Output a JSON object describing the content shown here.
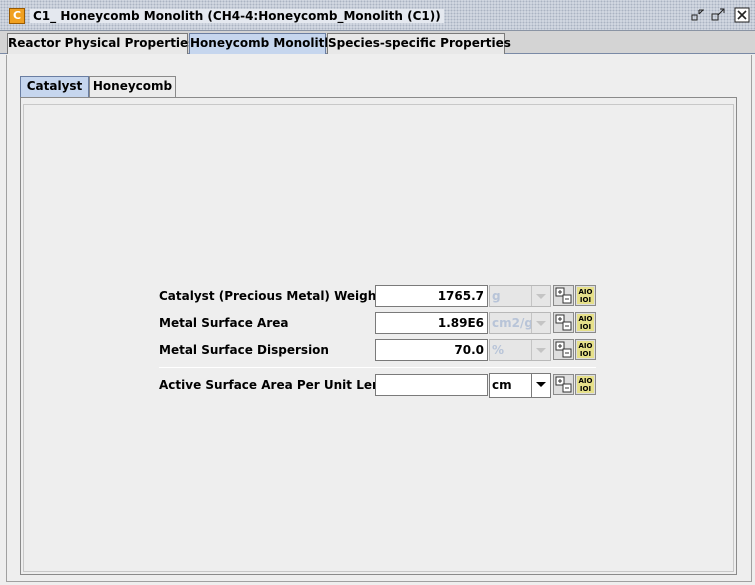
{
  "window": {
    "icon_letter": "C",
    "title": "C1_ Honeycomb Monolith  (CH4-4:Honeycomb_Monolith (C1))"
  },
  "top_tabs": [
    {
      "label": "Reactor Physical Properties",
      "active": false
    },
    {
      "label": "Honeycomb Monolith",
      "active": true
    },
    {
      "label": "Species-specific Properties",
      "active": false
    }
  ],
  "sub_tabs": [
    {
      "label": "Catalyst",
      "active": true
    },
    {
      "label": "Honeycomb",
      "active": false
    }
  ],
  "form": {
    "rows": [
      {
        "label": "Catalyst (Precious Metal) Weight",
        "value": "1765.7",
        "unit": "g",
        "unit_enabled": false
      },
      {
        "label": "Metal Surface Area",
        "value": "1.89E6",
        "unit": "cm2/g",
        "unit_enabled": false
      },
      {
        "label": "Metal Surface Dispersion",
        "value": "70.0",
        "unit": "%",
        "unit_enabled": false
      },
      {
        "label": "Active Surface Area Per Unit Length",
        "value": "",
        "unit": "cm",
        "unit_enabled": true
      }
    ]
  },
  "colors": {
    "active_tab": "#c6d6ee",
    "disabled_unit_text": "#b8c4d8",
    "app_icon": "#f0a020"
  }
}
